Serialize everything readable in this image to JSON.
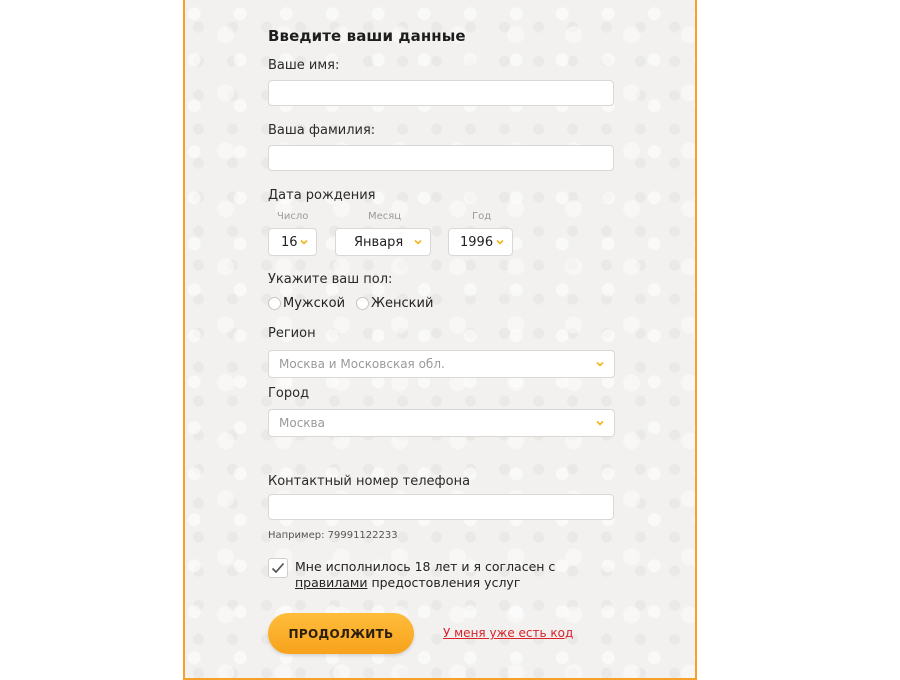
{
  "form": {
    "title": "Введите ваши данные",
    "first_name": {
      "label": "Ваше имя:",
      "value": "",
      "placeholder": ""
    },
    "last_name": {
      "label": "Ваша фамилия:",
      "value": "",
      "placeholder": ""
    },
    "birth_date": {
      "label": "Дата рождения",
      "day": {
        "label": "Число",
        "value": "16"
      },
      "month": {
        "label": "Месяц",
        "value": "Января"
      },
      "year": {
        "label": "Год",
        "value": "1996"
      }
    },
    "gender": {
      "label": "Укажите ваш пол:",
      "options": [
        "Мужской",
        "Женский"
      ]
    },
    "region": {
      "label": "Регион",
      "value": "Москва и Московская обл."
    },
    "city": {
      "label": "Город",
      "value": "Москва"
    },
    "phone": {
      "label": "Контактный номер телефона",
      "value": "",
      "hint": "Например: 79991122233"
    },
    "consent": {
      "text_before": "Мне исполнилось 18 лет и я согласен с ",
      "link": "правилами",
      "text_after": " предостовления услуг",
      "checked": true
    },
    "continue_button": "ПРОДОЛЖИТЬ",
    "have_code_link": "У меня уже есть код"
  },
  "colors": {
    "accent": "#f7a12a",
    "button": "#f7a21b",
    "link_red": "#d8232a",
    "chevron": "#f2b51b"
  },
  "icons": {
    "chevron": "chevron-down-icon",
    "check": "checkmark-icon"
  }
}
